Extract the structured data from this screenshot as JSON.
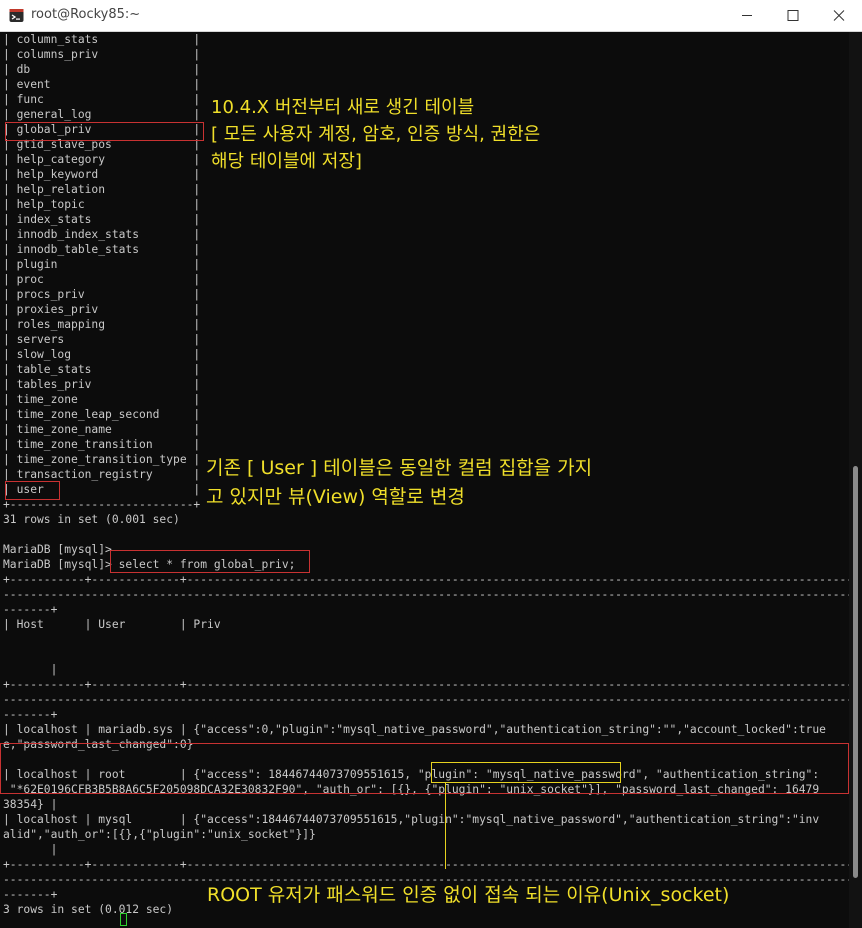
{
  "window": {
    "title": "root@Rocky85:~"
  },
  "colors": {
    "background": "#0c0c0c",
    "text": "#c9c9c9",
    "annotation": "#f0df2a",
    "highlight_box": "#c83232",
    "yellow_box": "#e6d21f"
  },
  "terminal": {
    "lines": [
      "| column_stats              |",
      "| columns_priv              |",
      "| db                        |",
      "| event                     |",
      "| func                      |",
      "| general_log               |",
      "| global_priv               |",
      "| gtid_slave_pos            |",
      "| help_category             |",
      "| help_keyword              |",
      "| help_relation             |",
      "| help_topic                |",
      "| index_stats               |",
      "| innodb_index_stats        |",
      "| innodb_table_stats        |",
      "| plugin                    |",
      "| proc                      |",
      "| procs_priv                |",
      "| proxies_priv              |",
      "| roles_mapping             |",
      "| servers                   |",
      "| slow_log                  |",
      "| table_stats               |",
      "| tables_priv               |",
      "| time_zone                 |",
      "| time_zone_leap_second     |",
      "| time_zone_name            |",
      "| time_zone_transition      |",
      "| time_zone_transition_type |",
      "| transaction_registry      |",
      "| user                      |",
      "+---------------------------+",
      "31 rows in set (0.001 sec)",
      "",
      "MariaDB [mysql]>",
      "MariaDB [mysql]> select * from global_priv;",
      "+-----------+-------------+-----------------------------------------------------------------------------------------------------------------",
      "-------------------------------------------------------------------------------------------------------------------------------------------",
      "-------+",
      "| Host      | User        | Priv",
      "",
      "",
      "       |",
      "+-----------+-------------+-----------------------------------------------------------------------------------------------------------------",
      "-------------------------------------------------------------------------------------------------------------------------------------------",
      "-------+",
      "| localhost | mariadb.sys | {\"access\":0,\"plugin\":\"mysql_native_password\",\"authentication_string\":\"\",\"account_locked\":true",
      "e,\"password_last_changed\":0}",
      "",
      "| localhost | root        | {\"access\": 18446744073709551615, \"plugin\": \"mysql_native_password\", \"authentication_string\":",
      " \"*62E0196CFB3B5B8A6C5F205098DCA32E30832F90\", \"auth_or\": [{}, {\"plugin\": \"unix_socket\"}], \"password_last_changed\": 16479",
      "38354} |",
      "| localhost | mysql       | {\"access\":18446744073709551615,\"plugin\":\"mysql_native_password\",\"authentication_string\":\"inv",
      "alid\",\"auth_or\":[{},{\"plugin\":\"unix_socket\"}]}",
      "       |",
      "+-----------+-------------+-----------------------------------------------------------------------------------------------------------------",
      "-------------------------------------------------------------------------------------------------------------------------------------------",
      "-------+",
      "3 rows in set (0.012 sec)",
      "",
      "MariaDB [mysql]> "
    ]
  },
  "annotations": {
    "global_priv_note": [
      "10.4.X 버전부터 새로 생긴 테이블",
      "[ 모든 사용자 계정, 암호, 인증 방식, 권한은",
      "해당 테이블에 저장]"
    ],
    "user_note": [
      "기존 [ User ] 테이블은 동일한 컬럼 집합을 가지",
      "고 있지만 뷰(View) 역할로 변경"
    ],
    "unix_socket_note": "ROOT 유저가 패스워드 인증 없이 접속 되는 이유(Unix_socket)"
  }
}
